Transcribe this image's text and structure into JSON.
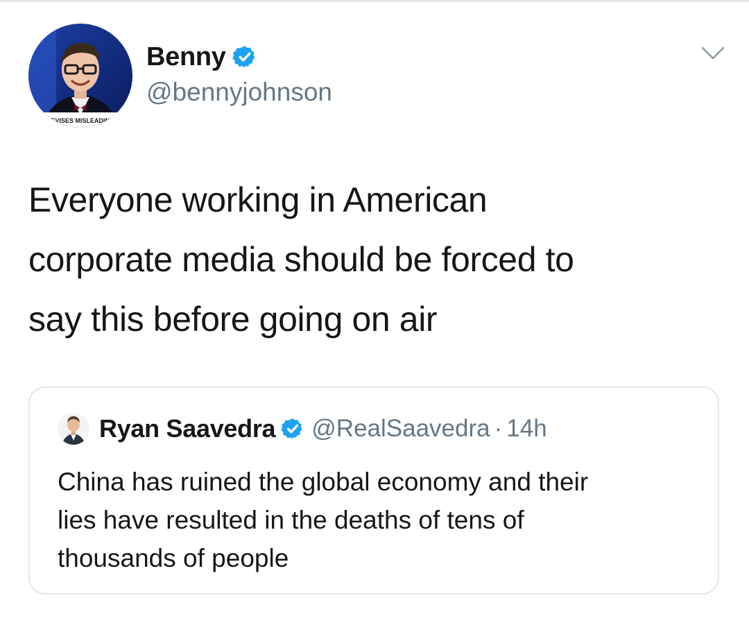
{
  "author": {
    "display_name": "Benny",
    "handle": "@bennyjohnson",
    "verified": true,
    "avatar_caption": "REVISES MISLEADING"
  },
  "tweet": {
    "text_lines": [
      "Everyone working in American",
      "corporate media should be forced to",
      "say this before going on air"
    ]
  },
  "quoted_tweet": {
    "display_name": "Ryan Saavedra",
    "handle": "@RealSaavedra",
    "separator": "·",
    "time": "14h",
    "verified": true,
    "text_lines": [
      "China has ruined the global economy and their",
      "lies have resulted in the deaths of tens of",
      "thousands of people"
    ]
  },
  "icons": {
    "verified": "verified-badge-icon",
    "menu": "chevron-down-icon"
  },
  "colors": {
    "text": "#14171a",
    "secondary": "#657786",
    "verified_blue": "#1da1f2",
    "border": "#e1e8ed"
  }
}
